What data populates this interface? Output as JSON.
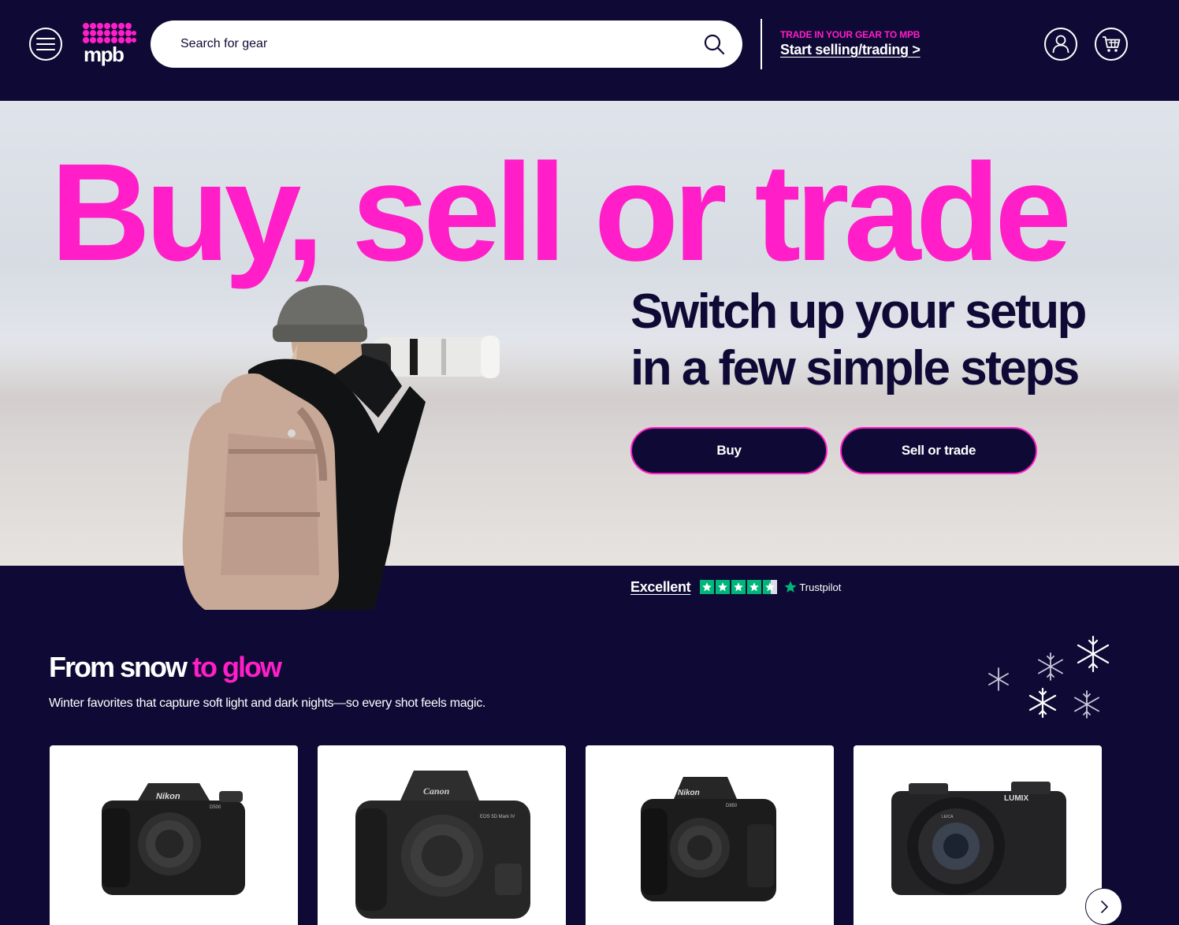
{
  "header": {
    "search_placeholder": "Search for gear",
    "trade_kicker": "TRADE IN YOUR GEAR TO MPB",
    "trade_link": "Start selling/trading >",
    "logo_text": "mpb"
  },
  "hero": {
    "title": "Buy, sell or trade",
    "subtitle": "Switch up your setup in a few simple steps",
    "buy_label": "Buy",
    "sell_label": "Sell or trade"
  },
  "trustpilot": {
    "rating_label": "Excellent",
    "brand": "Trustpilot",
    "stars": 4.5
  },
  "section": {
    "title_main": "From snow ",
    "title_accent": "to glow",
    "subtitle": "Winter favorites that capture soft light and dark nights—so every shot feels magic."
  },
  "products": [
    {
      "brand": "Nikon",
      "model": "D500"
    },
    {
      "brand": "Canon",
      "model": "EOS 5D Mark IV"
    },
    {
      "brand": "Nikon",
      "model": "D850"
    },
    {
      "brand": "LUMIX",
      "model": "LEICA"
    }
  ],
  "colors": {
    "navy": "#0f0a35",
    "pink": "#ff1ec8",
    "trustpilot_green": "#00b67a"
  }
}
